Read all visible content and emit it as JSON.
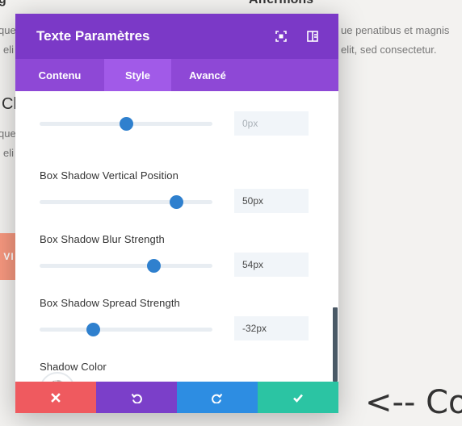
{
  "background": {
    "top_left_fragment": "g",
    "heading_fragment": "Affermons",
    "line1_left": "que",
    "line2_left": "eli",
    "line1_right": "ue penatibus et magnis",
    "line2_right": "elit, sed consectetur.",
    "big_heading_fragment": "Cl",
    "line3_left": "que",
    "line4_left": "eli",
    "cta_fragment": "VI",
    "arrow_text": "<-- Cor"
  },
  "modal": {
    "title": "Texte Paramètres",
    "header_icons": [
      "expand-icon",
      "split-view-icon"
    ],
    "tabs": [
      {
        "label": "Contenu",
        "active": false
      },
      {
        "label": "Style",
        "active": true
      },
      {
        "label": "Avancé",
        "active": false
      }
    ],
    "settings": [
      {
        "label": "",
        "value": "0px",
        "slider_fraction": 0.5
      },
      {
        "label": "Box Shadow Vertical Position",
        "value": "50px",
        "slider_fraction": 0.79
      },
      {
        "label": "Box Shadow Blur Strength",
        "value": "54px",
        "slider_fraction": 0.66
      },
      {
        "label": "Box Shadow Spread Strength",
        "value": "-32px",
        "slider_fraction": 0.31
      }
    ],
    "shadow_color_label": "Shadow Color",
    "swatch_colors": [
      "#1b1b1b",
      "#ffffff",
      "#e02b20",
      "#e09900",
      "#edf000",
      "#7cda24",
      "#0c71c3",
      "#8300e9"
    ],
    "footer_buttons": [
      {
        "name": "cancel",
        "icon": "close-icon",
        "color": "#ef5a5f"
      },
      {
        "name": "undo",
        "icon": "undo-icon",
        "color": "#7b3fc9"
      },
      {
        "name": "redo",
        "icon": "redo-icon",
        "color": "#2d8de2"
      },
      {
        "name": "save",
        "icon": "check-icon",
        "color": "#2bc4a3"
      }
    ]
  }
}
